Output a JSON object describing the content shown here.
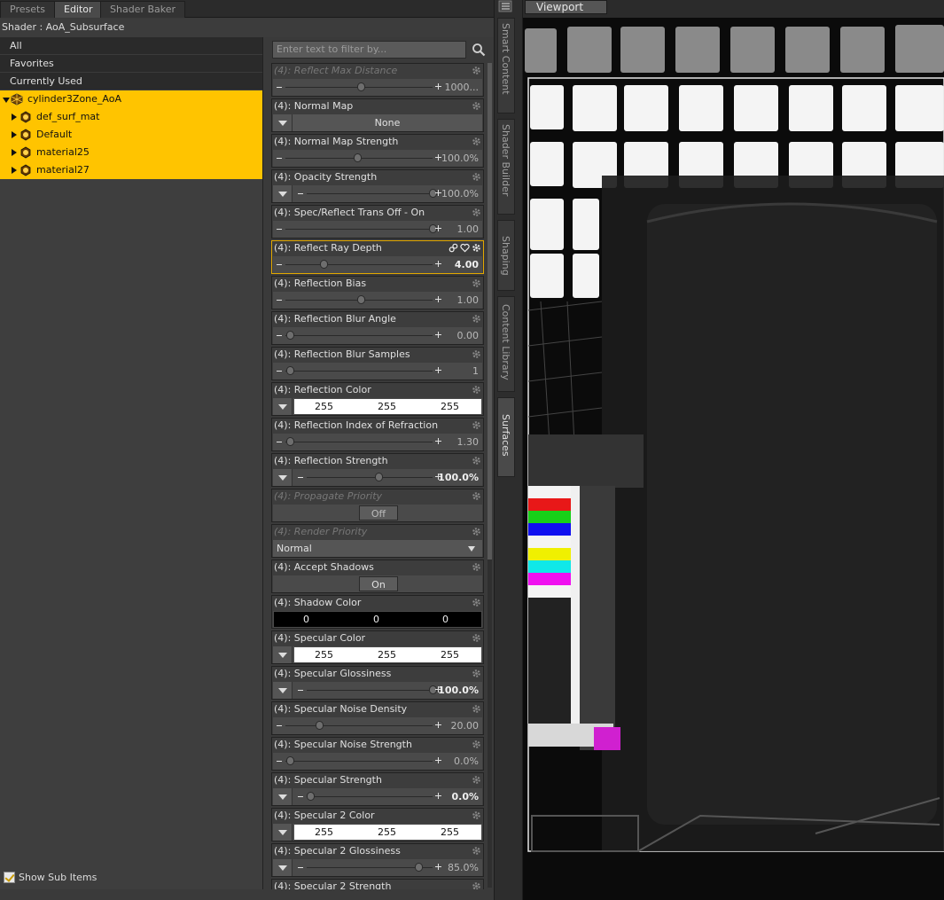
{
  "tabs": [
    "Presets",
    "Editor",
    "Shader Baker"
  ],
  "shader_title": "Shader : AoA_Subsurface",
  "categories": [
    "All",
    "Favorites",
    "Currently Used"
  ],
  "tree": {
    "root": "cylinder3Zone_AoA",
    "children": [
      "def_surf_mat",
      "Default",
      "material25",
      "material27"
    ]
  },
  "show_sub_items": "Show Sub Items",
  "filter_placeholder": "Enter text to filter by...",
  "props": [
    {
      "name": "(4): Reflect Max Distance",
      "value": "1000...",
      "disabled": true
    },
    {
      "name": "(4): Normal Map",
      "image_value": "None"
    },
    {
      "name": "(4): Normal Map Strength",
      "value": "100.0%"
    },
    {
      "name": "(4): Opacity Strength",
      "value": "100.0%"
    },
    {
      "name": "(4): Spec/Reflect Trans Off - On",
      "value": "1.00"
    },
    {
      "name": "(4): Reflect Ray Depth",
      "value": "4.00",
      "selected": true
    },
    {
      "name": "(4): Reflection Bias",
      "value": "1.00"
    },
    {
      "name": "(4): Reflection Blur Angle",
      "value": "0.00"
    },
    {
      "name": "(4): Reflection Blur Samples",
      "value": "1"
    },
    {
      "name": "(4): Reflection Color",
      "color": [
        "255",
        "255",
        "255"
      ]
    },
    {
      "name": "(4): Reflection Index of Refraction",
      "value": "1.30"
    },
    {
      "name": "(4): Reflection Strength",
      "value": "100.0%"
    },
    {
      "name": "(4): Propagate Priority",
      "toggle": "Off",
      "disabled": true
    },
    {
      "name": "(4): Render Priority",
      "select": "Normal",
      "disabled": true
    },
    {
      "name": "(4): Accept Shadows",
      "toggle": "On"
    },
    {
      "name": "(4): Shadow Color",
      "color": [
        "0",
        "0",
        "0"
      ]
    },
    {
      "name": "(4): Specular Color",
      "color": [
        "255",
        "255",
        "255"
      ]
    },
    {
      "name": "(4): Specular Glossiness",
      "value": "100.0%"
    },
    {
      "name": "(4): Specular Noise Density",
      "value": "20.00"
    },
    {
      "name": "(4): Specular Noise Strength",
      "value": "0.0%"
    },
    {
      "name": "(4): Specular Strength",
      "value": "0.0%"
    },
    {
      "name": "(4): Specular 2 Color",
      "color": [
        "255",
        "255",
        "255"
      ]
    },
    {
      "name": "(4): Specular 2 Glossiness",
      "value": "85.0%"
    },
    {
      "name": "(4): Specular 2 Strength",
      "value": ""
    }
  ],
  "side_tabs": [
    "Smart Content",
    "Shader Builder",
    "Shaping",
    "Content Library",
    "Surfaces"
  ],
  "viewport_tab": "Viewport",
  "colors": {
    "selection": "#ffc400",
    "panel": "#3a3a3a",
    "accent_border": "#e2a800"
  }
}
